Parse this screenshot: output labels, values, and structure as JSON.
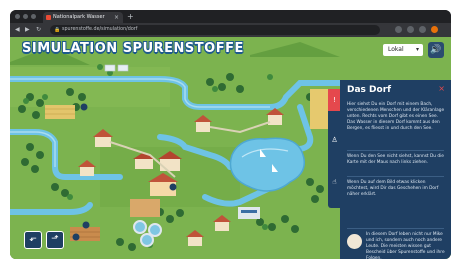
{
  "browser": {
    "tab_title": "Nationalpark Wasser",
    "url": "spurenstoffe.de/simulation/dorf",
    "new_tab": "+",
    "tab_close": "×"
  },
  "game": {
    "title": "SIMULATION SPURENSTOFFE",
    "view_select": {
      "value": "Lokal"
    },
    "sound_icon": "speaker-icon"
  },
  "panel": {
    "title": "Das Dorf",
    "close": "×",
    "paragraphs": [
      "Hier siehst Du ein Dorf mit einem Bach, verschiedenen Menschen und der Kläranlage unten. Rechts vom Dorf gibt es einen See. Das Wasser in diesem Dorf kommt aus den Bergen, es fliesst in und durch den See.",
      "Wenn Du den See nicht siehst, kannst Du die Karte mit der Maus nach links ziehen.",
      "Wenn Du auf dem Bild etwas klicken möchtest, wird Dir das Geschehen im Dorf näher erklärt.",
      "In diesem Dorf leben nicht nur Mike und ich, sondern auch noch andere Leute. Die meisten wissen gut Bescheid über Spurenstoffe und ihre Folgen."
    ]
  },
  "colors": {
    "accent": "#e5484d",
    "panel": "#1f3f63",
    "grass": "#79b04c",
    "water": "#6ec3e6"
  }
}
